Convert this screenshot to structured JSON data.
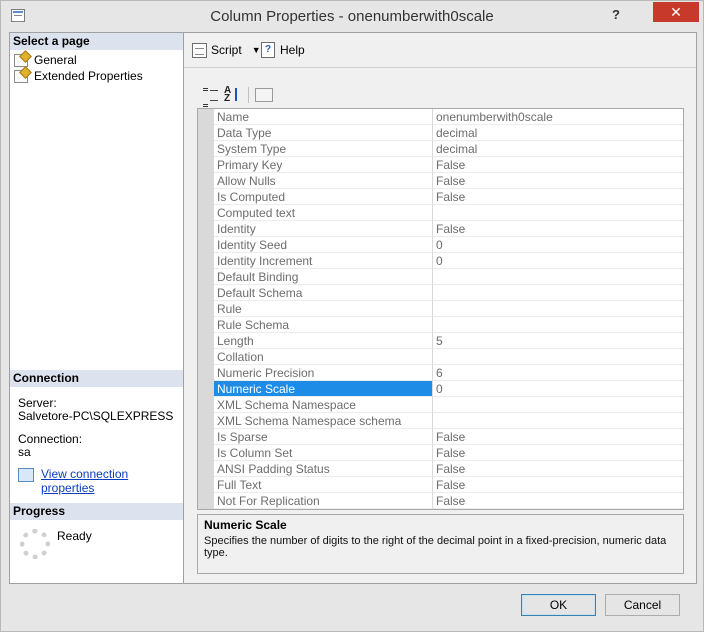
{
  "window": {
    "title": "Column Properties - onenumberwith0scale",
    "help_glyph": "?",
    "close_glyph": "✕"
  },
  "sidebar": {
    "select_page_header": "Select a page",
    "pages": [
      {
        "label": "General",
        "icon": "page-wrench-icon"
      },
      {
        "label": "Extended Properties",
        "icon": "page-wrench-icon"
      }
    ],
    "connection_header": "Connection",
    "server_label": "Server:",
    "server_value": "Salvetore-PC\\SQLEXPRESS",
    "connection_label": "Connection:",
    "connection_value": "sa",
    "view_connection_link": "View connection properties",
    "progress_header": "Progress",
    "progress_status": "Ready"
  },
  "toolbar": {
    "script_label": "Script",
    "help_label": "Help"
  },
  "properties": [
    {
      "name": "Name",
      "value": "onenumberwith0scale"
    },
    {
      "name": "Data Type",
      "value": "decimal"
    },
    {
      "name": "System Type",
      "value": "decimal"
    },
    {
      "name": "Primary Key",
      "value": "False"
    },
    {
      "name": "Allow Nulls",
      "value": "False"
    },
    {
      "name": "Is Computed",
      "value": "False"
    },
    {
      "name": "Computed text",
      "value": ""
    },
    {
      "name": "Identity",
      "value": "False"
    },
    {
      "name": "Identity Seed",
      "value": "0"
    },
    {
      "name": "Identity Increment",
      "value": "0"
    },
    {
      "name": "Default Binding",
      "value": ""
    },
    {
      "name": "Default Schema",
      "value": ""
    },
    {
      "name": "Rule",
      "value": ""
    },
    {
      "name": "Rule Schema",
      "value": ""
    },
    {
      "name": "Length",
      "value": "5"
    },
    {
      "name": "Collation",
      "value": ""
    },
    {
      "name": "Numeric Precision",
      "value": "6"
    },
    {
      "name": "Numeric Scale",
      "value": "0",
      "selected": true
    },
    {
      "name": "XML Schema Namespace",
      "value": ""
    },
    {
      "name": "XML Schema Namespace schema",
      "value": ""
    },
    {
      "name": "Is Sparse",
      "value": "False"
    },
    {
      "name": "Is Column Set",
      "value": "False"
    },
    {
      "name": "ANSI Padding Status",
      "value": "False"
    },
    {
      "name": "Full Text",
      "value": "False"
    },
    {
      "name": "Not For Replication",
      "value": "False"
    }
  ],
  "description": {
    "title": "Numeric Scale",
    "text": "Specifies the number of digits to the right of the decimal point in a fixed-precision, numeric data type."
  },
  "buttons": {
    "ok": "OK",
    "cancel": "Cancel"
  },
  "colors": {
    "selection": "#1c8ce6",
    "close_button": "#c7392b",
    "link": "#0b3dbf",
    "section_header": "#dde3ee"
  }
}
